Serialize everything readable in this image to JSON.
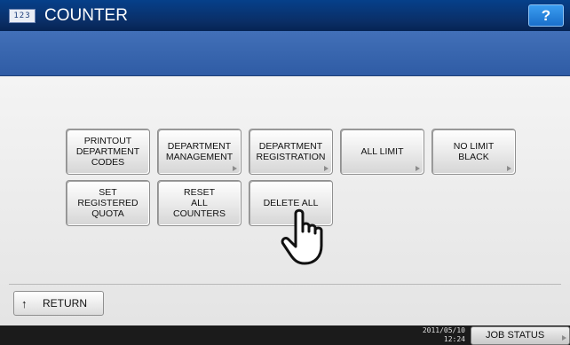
{
  "header": {
    "app_icon_text": "123",
    "title": "COUNTER",
    "help_label": "?"
  },
  "menu": {
    "buttons": [
      {
        "label": "PRINTOUT\nDEPARTMENT\nCODES",
        "has_submenu": false
      },
      {
        "label": "DEPARTMENT\nMANAGEMENT",
        "has_submenu": true
      },
      {
        "label": "DEPARTMENT\nREGISTRATION",
        "has_submenu": true
      },
      {
        "label": "ALL LIMIT",
        "has_submenu": true
      },
      {
        "label": "NO LIMIT\nBLACK",
        "has_submenu": true
      },
      {
        "label": "SET\nREGISTERED\nQUOTA",
        "has_submenu": false
      },
      {
        "label": "RESET\nALL\nCOUNTERS",
        "has_submenu": false
      },
      {
        "label": "DELETE ALL",
        "has_submenu": false
      }
    ]
  },
  "footer": {
    "return_icon": "↑",
    "return_label": "RETURN",
    "date": "2011/05/10",
    "time": "12:24",
    "job_status_label": "JOB STATUS"
  },
  "icons": {
    "app": "counter-icon",
    "help": "question-icon",
    "return": "return-arrow-icon",
    "pointer": "hand-pointer-icon",
    "submenu": "triangle-right-icon"
  },
  "colors": {
    "title_bar": "#0a2e66",
    "sub_bar": "#3a66ae",
    "help_button": "#1a6fcb",
    "status_bar": "#1b1b1b"
  }
}
